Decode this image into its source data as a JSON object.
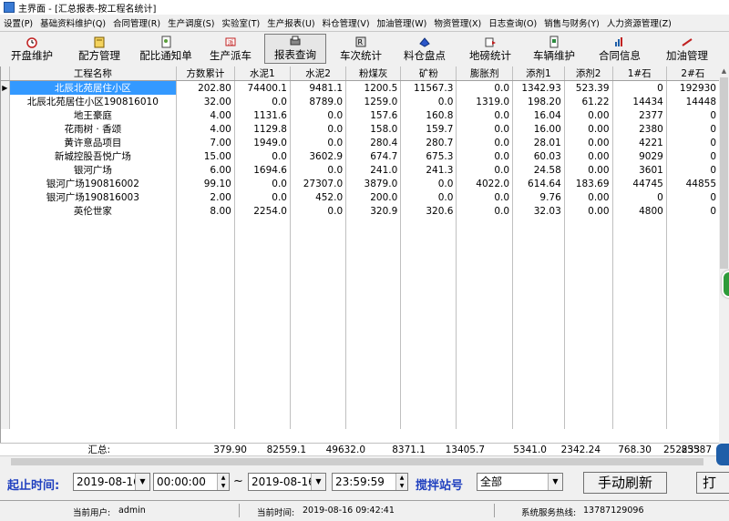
{
  "window": {
    "title": "主界面 - [汇总报表-按工程名统计]"
  },
  "menu": [
    "设置(P)",
    "基础资料维护(Q)",
    "合同管理(R)",
    "生产调度(S)",
    "实验室(T)",
    "生产报表(U)",
    "料仓管理(V)",
    "加油管理(W)",
    "物资管理(X)",
    "日志查询(O)",
    "销售与财务(Y)",
    "人力资源管理(Z)"
  ],
  "toolbar": [
    {
      "label": "开盘维护",
      "icon": "alarm-clock-icon"
    },
    {
      "label": "配方管理",
      "icon": "recipe-book-icon"
    },
    {
      "label": "配比通知单",
      "icon": "notice-doc-icon"
    },
    {
      "label": "生产派车",
      "icon": "dispatch-icon"
    },
    {
      "label": "报表查询",
      "icon": "report-printer-icon"
    },
    {
      "label": "车次统计",
      "icon": "trip-stats-icon"
    },
    {
      "label": "料仓盘点",
      "icon": "inventory-icon"
    },
    {
      "label": "地磅统计",
      "icon": "scale-icon"
    },
    {
      "label": "车辆维护",
      "icon": "vehicle-icon"
    },
    {
      "label": "合同信息",
      "icon": "contract-icon"
    },
    {
      "label": "加油管理",
      "icon": "fuel-icon"
    }
  ],
  "table": {
    "columns": [
      "工程名称",
      "方数累计",
      "水泥1",
      "水泥2",
      "粉煤灰",
      "矿粉",
      "膨胀剂",
      "添剂1",
      "添剂2",
      "1#石",
      "2#石"
    ],
    "rows": [
      [
        "北辰北苑居住小区",
        "202.80",
        "74400.1",
        "9481.1",
        "1200.5",
        "11567.3",
        "0.0",
        "1342.93",
        "523.39",
        "0",
        "192930"
      ],
      [
        "北辰北苑居住小区190816010",
        "32.00",
        "0.0",
        "8789.0",
        "1259.0",
        "0.0",
        "1319.0",
        "198.20",
        "61.22",
        "14434",
        "14448"
      ],
      [
        "地王豪庭",
        "4.00",
        "1131.6",
        "0.0",
        "157.6",
        "160.8",
        "0.0",
        "16.04",
        "0.00",
        "2377",
        "0"
      ],
      [
        "花雨树 · 香颂",
        "4.00",
        "1129.8",
        "0.0",
        "158.0",
        "159.7",
        "0.0",
        "16.00",
        "0.00",
        "2380",
        "0"
      ],
      [
        "黄许意品项目",
        "7.00",
        "1949.0",
        "0.0",
        "280.4",
        "280.7",
        "0.0",
        "28.01",
        "0.00",
        "4221",
        "0"
      ],
      [
        "新城控股吾悦广场",
        "15.00",
        "0.0",
        "3602.9",
        "674.7",
        "675.3",
        "0.0",
        "60.03",
        "0.00",
        "9029",
        "0"
      ],
      [
        "银河广场",
        "6.00",
        "1694.6",
        "0.0",
        "241.0",
        "241.3",
        "0.0",
        "24.58",
        "0.00",
        "3601",
        "0"
      ],
      [
        "银河广场190816002",
        "99.10",
        "0.0",
        "27307.0",
        "3879.0",
        "0.0",
        "4022.0",
        "614.64",
        "183.69",
        "44745",
        "44855"
      ],
      [
        "银河广场190816003",
        "2.00",
        "0.0",
        "452.0",
        "200.0",
        "0.0",
        "0.0",
        "9.76",
        "0.00",
        "0",
        "0"
      ],
      [
        "英伦世家",
        "8.00",
        "2254.0",
        "0.0",
        "320.9",
        "320.6",
        "0.0",
        "32.03",
        "0.00",
        "4800",
        "0"
      ]
    ],
    "row_indicator": "▶",
    "totals_label": "汇总:",
    "totals": [
      "379.90",
      "82559.1",
      "49632.0",
      "8371.1",
      "13405.7",
      "5341.0",
      "2342.24",
      "768.30",
      "85587",
      "252233"
    ]
  },
  "filter": {
    "label": "起止时间:",
    "start_date": "2019-08-16",
    "start_time": "00:00:00",
    "range_sep": "~",
    "end_date": "2019-08-16",
    "end_time": "23:59:59",
    "station_label": "搅拌站号",
    "station_value": "全部",
    "refresh_label": "手动刷新",
    "print_label": "打"
  },
  "status": {
    "user_label": "当前用户:",
    "user": "admin",
    "time_label": "当前时间:",
    "time": "2019-08-16 09:42:41",
    "hotline_label": "系统服务热线:",
    "hotline": "13787129096"
  },
  "colors": {
    "selection": "#3399ff",
    "label_blue": "#1f3fbf"
  }
}
